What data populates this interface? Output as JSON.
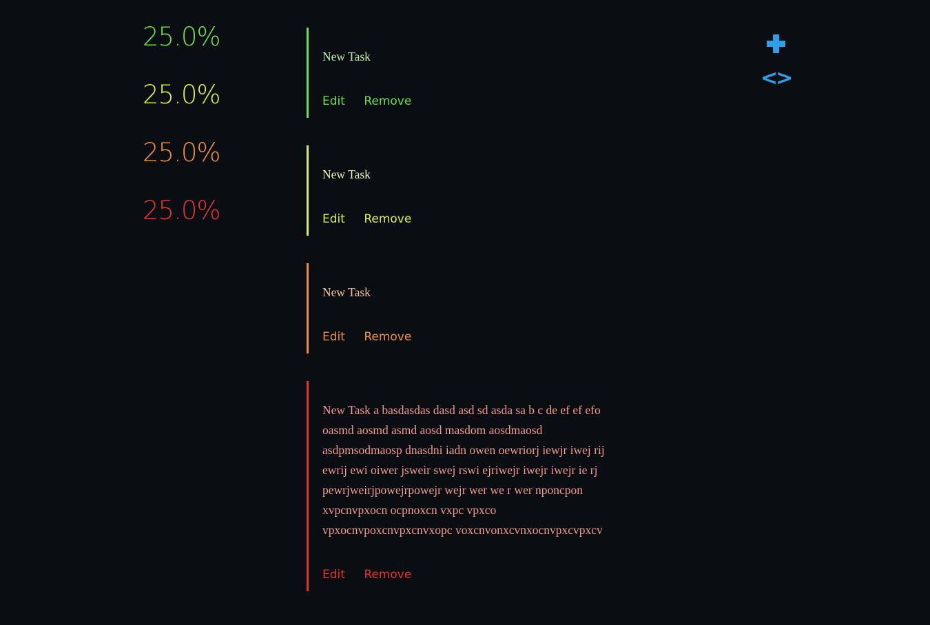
{
  "stats": [
    {
      "label": "25.0%",
      "color": "#6ee04a"
    },
    {
      "label": "25.0%",
      "color": "#dcf04a"
    },
    {
      "label": "25.0%",
      "color": "#f0913a"
    },
    {
      "label": "25.0%",
      "color": "#e83232"
    }
  ],
  "tasks": [
    {
      "text": "New Task",
      "edit_label": "Edit",
      "remove_label": "Remove",
      "color": "#6ee04a",
      "text_color": "#c6f0b3"
    },
    {
      "text": "New Task",
      "edit_label": "Edit",
      "remove_label": "Remove",
      "color": "#dcf04a",
      "text_color": "#eef5b8"
    },
    {
      "text": "New Task",
      "edit_label": "Edit",
      "remove_label": "Remove",
      "color": "#f0913a",
      "text_color": "#f2c59c"
    },
    {
      "text": "New Task a basdasdas dasd asd sd asda sa b c de ef ef efo oasmd aosmd asmd aosd masdom aosdmaosd asdpmsodmaosp dnasdni iadn owen oewriorj iewjr iwej rij ewrij ewi oiwer jsweir swej rswi ejriwejr iwejr iwejr ie rj pewrjweirjpowejrpowejr wejr wer we r wer nponcpon xvpcnvpxocn ocpnoxcn vxpc vpxco vpxocnvpoxcnvpxcnvxopc voxcnvonxcvnxocnvpxcvpxcv",
      "edit_label": "Edit",
      "remove_label": "Remove",
      "color": "#e83232",
      "text_color": "#f29a93"
    }
  ],
  "controls": {
    "add_icon": "plus-icon",
    "code_icon": "code-icon",
    "code_glyph": "<>",
    "accent": "#2f9ee6"
  }
}
